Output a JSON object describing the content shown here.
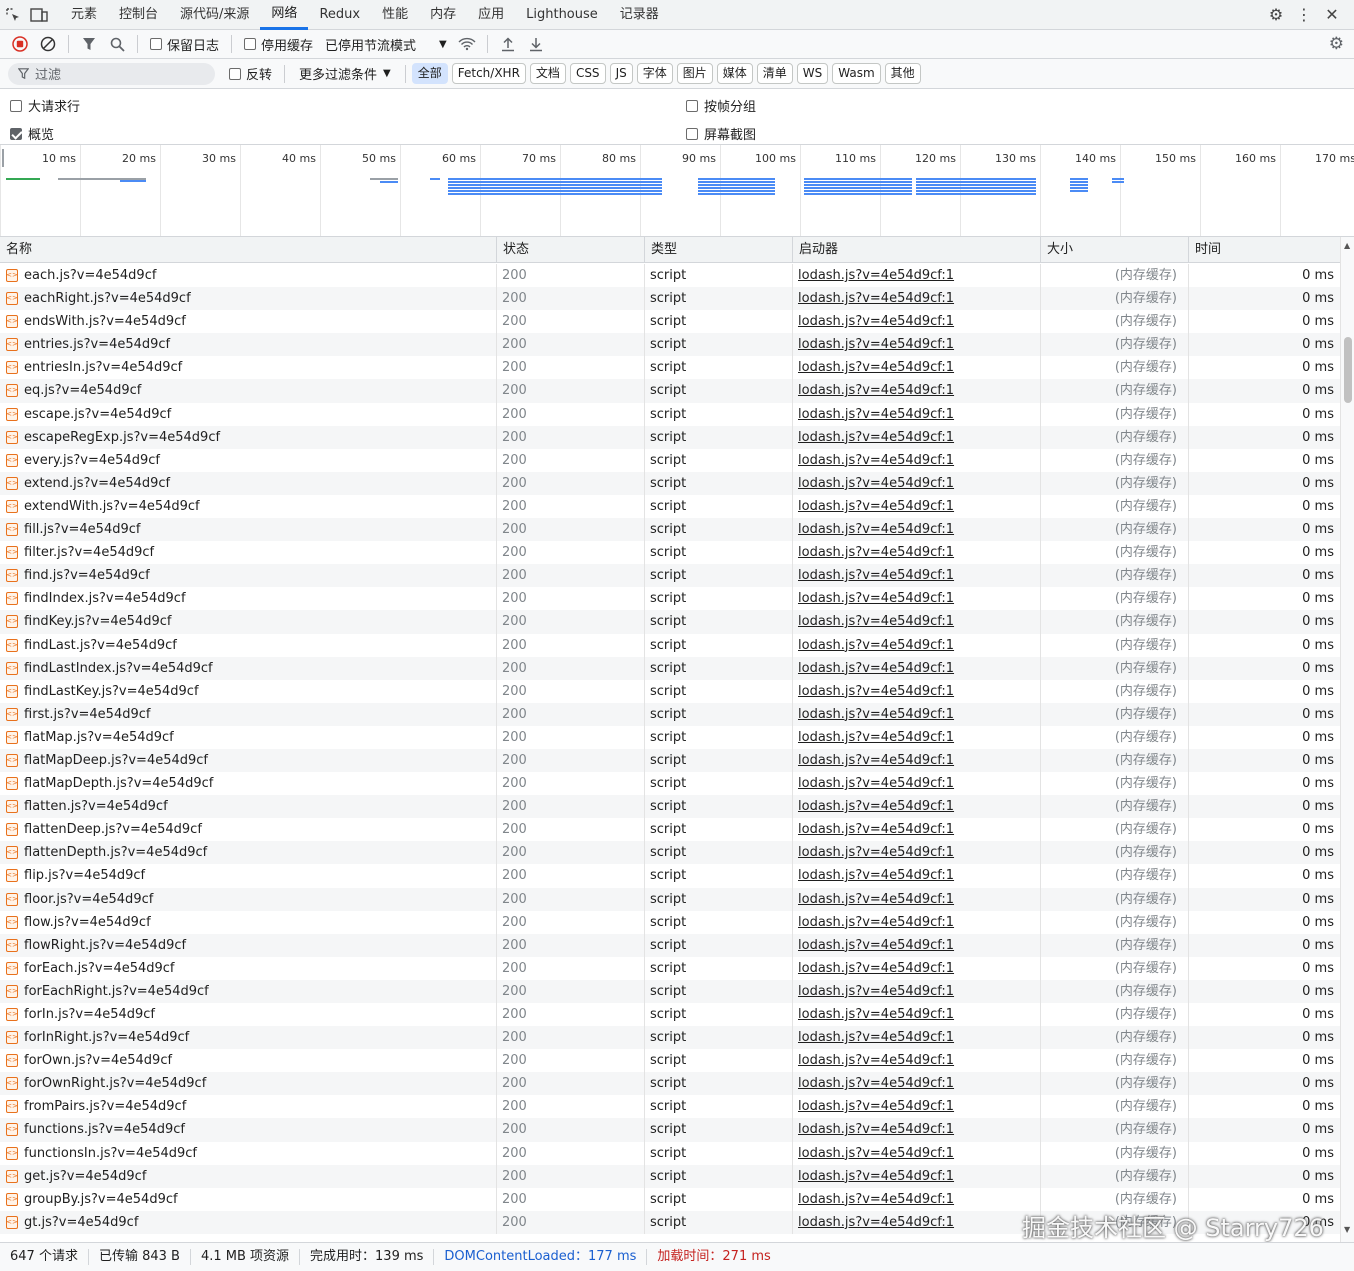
{
  "tabs": [
    "元素",
    "控制台",
    "源代码/来源",
    "网络",
    "Redux",
    "性能",
    "内存",
    "应用",
    "Lighthouse",
    "记录器"
  ],
  "active_tab": "网络",
  "toolbar": {
    "preserve_log": "保留日志",
    "disable_cache": "停用缓存",
    "throttle": "已停用节流模式"
  },
  "filter": {
    "placeholder": "过滤",
    "invert": "反转",
    "more_filters": "更多过滤条件",
    "types": [
      "全部",
      "Fetch/XHR",
      "文档",
      "CSS",
      "JS",
      "字体",
      "图片",
      "媒体",
      "清单",
      "WS",
      "Wasm",
      "其他"
    ],
    "selected_type": "全部"
  },
  "options": {
    "big_rows": "大请求行",
    "group_by_frame": "按帧分组",
    "overview": "概览",
    "screenshots": "屏幕截图",
    "overview_checked": true
  },
  "timeline_ticks": [
    "10 ms",
    "20 ms",
    "30 ms",
    "40 ms",
    "50 ms",
    "60 ms",
    "70 ms",
    "80 ms",
    "90 ms",
    "100 ms",
    "110 ms",
    "120 ms",
    "130 ms",
    "140 ms",
    "150 ms",
    "160 ms",
    "170 ms"
  ],
  "columns": [
    "名称",
    "状态",
    "类型",
    "启动器",
    "大小",
    "时间"
  ],
  "row_defaults": {
    "status": "200",
    "type": "script",
    "initiator": "lodash.js?v=4e54d9cf:1",
    "size": "(内存缓存)",
    "time": "0 ms"
  },
  "rows": [
    "each.js?v=4e54d9cf",
    "eachRight.js?v=4e54d9cf",
    "endsWith.js?v=4e54d9cf",
    "entries.js?v=4e54d9cf",
    "entriesIn.js?v=4e54d9cf",
    "eq.js?v=4e54d9cf",
    "escape.js?v=4e54d9cf",
    "escapeRegExp.js?v=4e54d9cf",
    "every.js?v=4e54d9cf",
    "extend.js?v=4e54d9cf",
    "extendWith.js?v=4e54d9cf",
    "fill.js?v=4e54d9cf",
    "filter.js?v=4e54d9cf",
    "find.js?v=4e54d9cf",
    "findIndex.js?v=4e54d9cf",
    "findKey.js?v=4e54d9cf",
    "findLast.js?v=4e54d9cf",
    "findLastIndex.js?v=4e54d9cf",
    "findLastKey.js?v=4e54d9cf",
    "first.js?v=4e54d9cf",
    "flatMap.js?v=4e54d9cf",
    "flatMapDeep.js?v=4e54d9cf",
    "flatMapDepth.js?v=4e54d9cf",
    "flatten.js?v=4e54d9cf",
    "flattenDeep.js?v=4e54d9cf",
    "flattenDepth.js?v=4e54d9cf",
    "flip.js?v=4e54d9cf",
    "floor.js?v=4e54d9cf",
    "flow.js?v=4e54d9cf",
    "flowRight.js?v=4e54d9cf",
    "forEach.js?v=4e54d9cf",
    "forEachRight.js?v=4e54d9cf",
    "forIn.js?v=4e54d9cf",
    "forInRight.js?v=4e54d9cf",
    "forOwn.js?v=4e54d9cf",
    "forOwnRight.js?v=4e54d9cf",
    "fromPairs.js?v=4e54d9cf",
    "functions.js?v=4e54d9cf",
    "functionsIn.js?v=4e54d9cf",
    "get.js?v=4e54d9cf",
    "groupBy.js?v=4e54d9cf",
    "gt.js?v=4e54d9cf"
  ],
  "status_bar": {
    "requests": "647 个请求",
    "transferred": "已传输 843 B",
    "resources": "4.1 MB 项资源",
    "finish": "完成用时：139 ms",
    "dcl": "DOMContentLoaded：177 ms",
    "load": "加载时间：271 ms"
  },
  "watermark": "掘金技术社区 @ Starry726",
  "colors": {
    "accent": "#1a73e8",
    "record": "#d93025",
    "js_icon": "#e8711c"
  }
}
